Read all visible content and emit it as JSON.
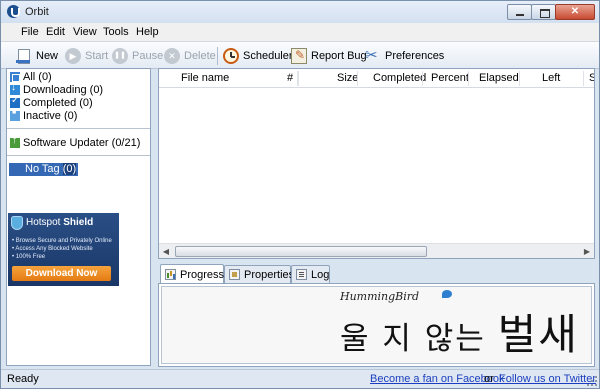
{
  "window": {
    "title": "Orbit"
  },
  "menu": [
    "File",
    "Edit",
    "View",
    "Tools",
    "Help"
  ],
  "toolbar": {
    "new": "New",
    "start": "Start",
    "pause": "Pause",
    "delete": "Delete",
    "scheduler": "Scheduler",
    "report_bug": "Report Bug",
    "preferences": "Preferences"
  },
  "categories": [
    {
      "label": "All (0)",
      "icon": "all-icon"
    },
    {
      "label": "Downloading (0)",
      "icon": "downloading-icon"
    },
    {
      "label": "Completed (0)",
      "icon": "completed-icon"
    },
    {
      "label": "Inactive (0)",
      "icon": "inactive-icon"
    }
  ],
  "updater": {
    "label": "Software Updater (0/21)"
  },
  "tag": {
    "label": "No Tag",
    "count": "(0)"
  },
  "ad": {
    "brand_prefix": "Hotspot",
    "brand_suffix": "Shield",
    "lines": [
      "• Browse Secure and Privately Online",
      "• Access Any Blocked Website",
      "• 100% Free"
    ],
    "cta": "Download Now"
  },
  "columns": [
    "File name",
    "#",
    "Size",
    "Completed",
    "Percent",
    "Elapsed",
    "Left",
    "S"
  ],
  "tabs": {
    "progress": "Progress",
    "properties": "Properties",
    "log": "Log"
  },
  "banner": {
    "logo": "HummingBird",
    "line": "울 지 않는",
    "big": "벌새"
  },
  "status": {
    "text": "Ready",
    "facebook": "Become a fan on Facebook",
    "or": "or",
    "twitter": "Follow us on Twitter"
  }
}
